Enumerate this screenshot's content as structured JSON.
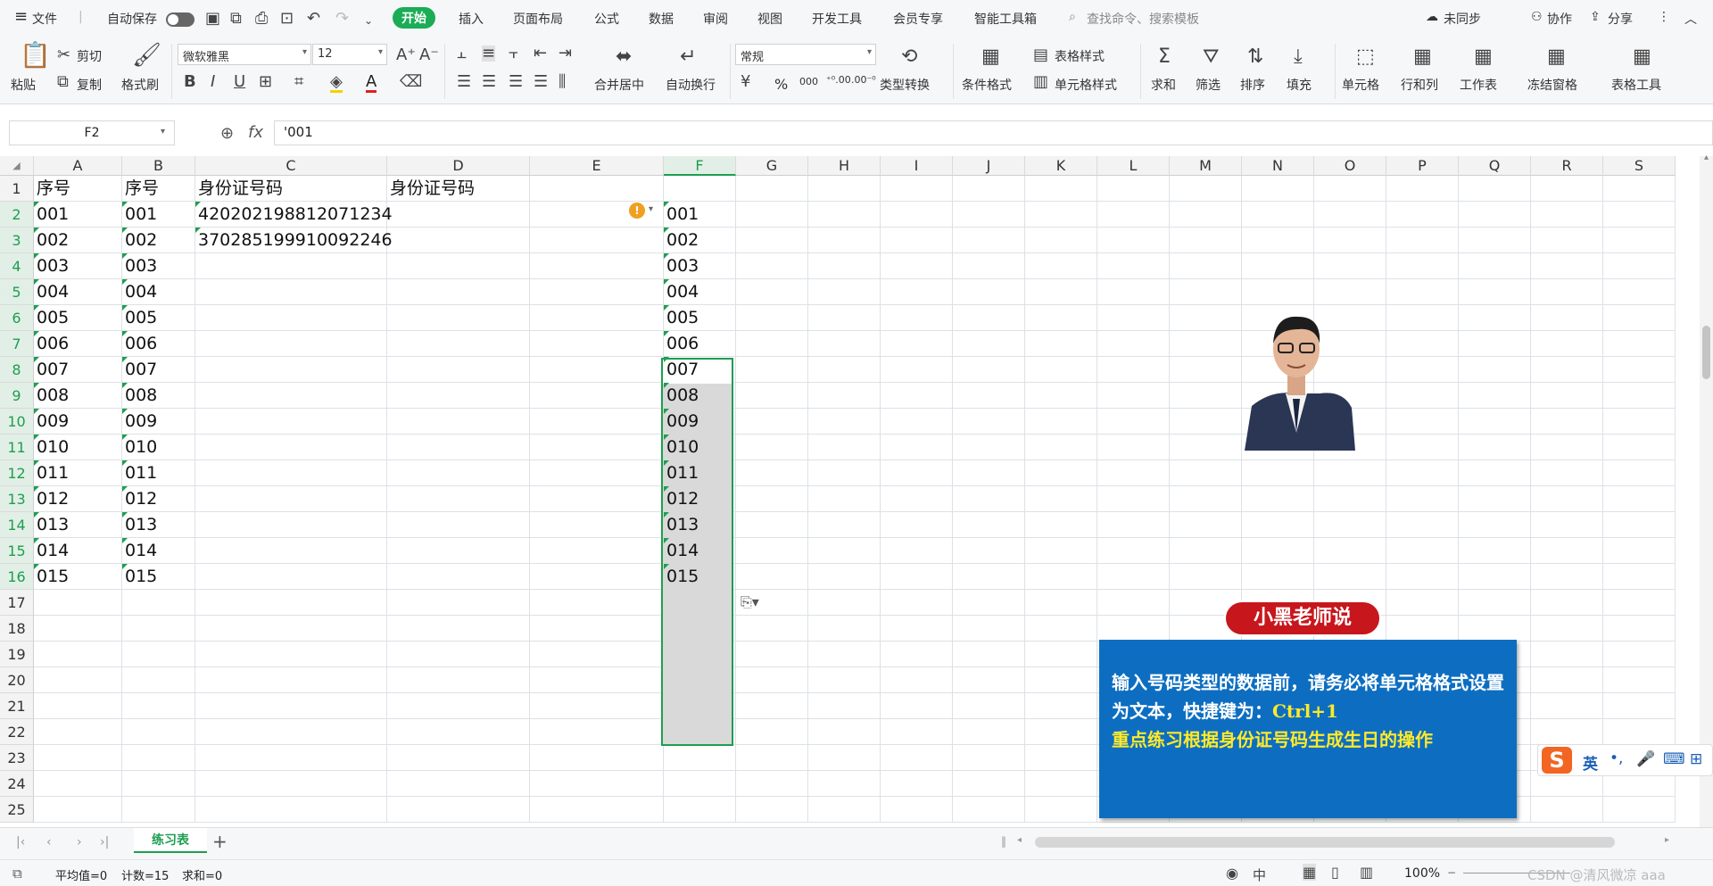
{
  "menu": {
    "hamburger": "≡",
    "file": "文件",
    "autosave": "自动保存",
    "items": [
      "开始",
      "插入",
      "页面布局",
      "公式",
      "数据",
      "审阅",
      "视图",
      "开发工具",
      "会员专享",
      "智能工具箱"
    ],
    "search": "查找命令、搜索模板",
    "sync": "未同步",
    "collab": "协作",
    "share": "分享"
  },
  "ribbon": {
    "paste": "粘贴",
    "cut": "剪切",
    "copy": "复制",
    "format_painter": "格式刷",
    "font": "微软雅黑",
    "size": "12",
    "merge": "合并居中",
    "wrap": "自动换行",
    "number_format": "常规",
    "type_convert": "类型转换",
    "cond_format": "条件格式",
    "table_style": "表格样式",
    "cell_style": "单元格样式",
    "sum": "求和",
    "filter": "筛选",
    "sort": "排序",
    "fill": "填充",
    "cells": "单元格",
    "rowcol": "行和列",
    "sheet": "工作表",
    "freeze": "冻结窗格",
    "table_tools": "表格工具",
    "percent": "%",
    "thousands": "000",
    "dec_inc": "⁺⁰.00",
    "dec_dec": ".00⁻⁰"
  },
  "formula": {
    "namebox": "F2",
    "content": "'001",
    "fx": "fx"
  },
  "columns": [
    "A",
    "B",
    "C",
    "D",
    "E",
    "F",
    "G",
    "H",
    "I",
    "J",
    "K",
    "L",
    "M",
    "N",
    "O",
    "P",
    "Q",
    "R",
    "S"
  ],
  "rows": [
    "1",
    "2",
    "3",
    "4",
    "5",
    "6",
    "7",
    "8",
    "9",
    "10",
    "11",
    "12",
    "13",
    "14",
    "15",
    "16",
    "17",
    "18",
    "19",
    "20",
    "21",
    "22",
    "23",
    "24",
    "25"
  ],
  "cells": {
    "headers": {
      "A1": "序号",
      "B1": "序号",
      "C1": "身份证号码",
      "D1": "身份证号码"
    },
    "ids": {
      "C2": "420202198812071234",
      "C3": "370285199910092246"
    },
    "seq": [
      "001",
      "002",
      "003",
      "004",
      "005",
      "006",
      "007",
      "008",
      "009",
      "010",
      "011",
      "012",
      "013",
      "014",
      "015"
    ]
  },
  "callout": {
    "badge": "小黑老师说",
    "line1": "输入号码类型的数据前，请务必将单元格格式设置为文本，快捷键为：",
    "shortcut": "Ctrl+1",
    "line2": "重点练习根据身份证号码生成生日的操作"
  },
  "sheet_tabs": {
    "active": "练习表",
    "add": "+"
  },
  "status": {
    "avg": "平均值=0",
    "count": "计数=15",
    "sum": "求和=0",
    "zoom": "100%",
    "watermark": "CSDN @清风微凉 aaa",
    "lang": "中"
  },
  "ime": {
    "logo": "S",
    "lang": "英"
  },
  "colors": {
    "accent": "#1e9e50",
    "callout_bg": "#0d6ec1",
    "badge_bg": "#c8161d",
    "highlight": "#ffea2a"
  }
}
